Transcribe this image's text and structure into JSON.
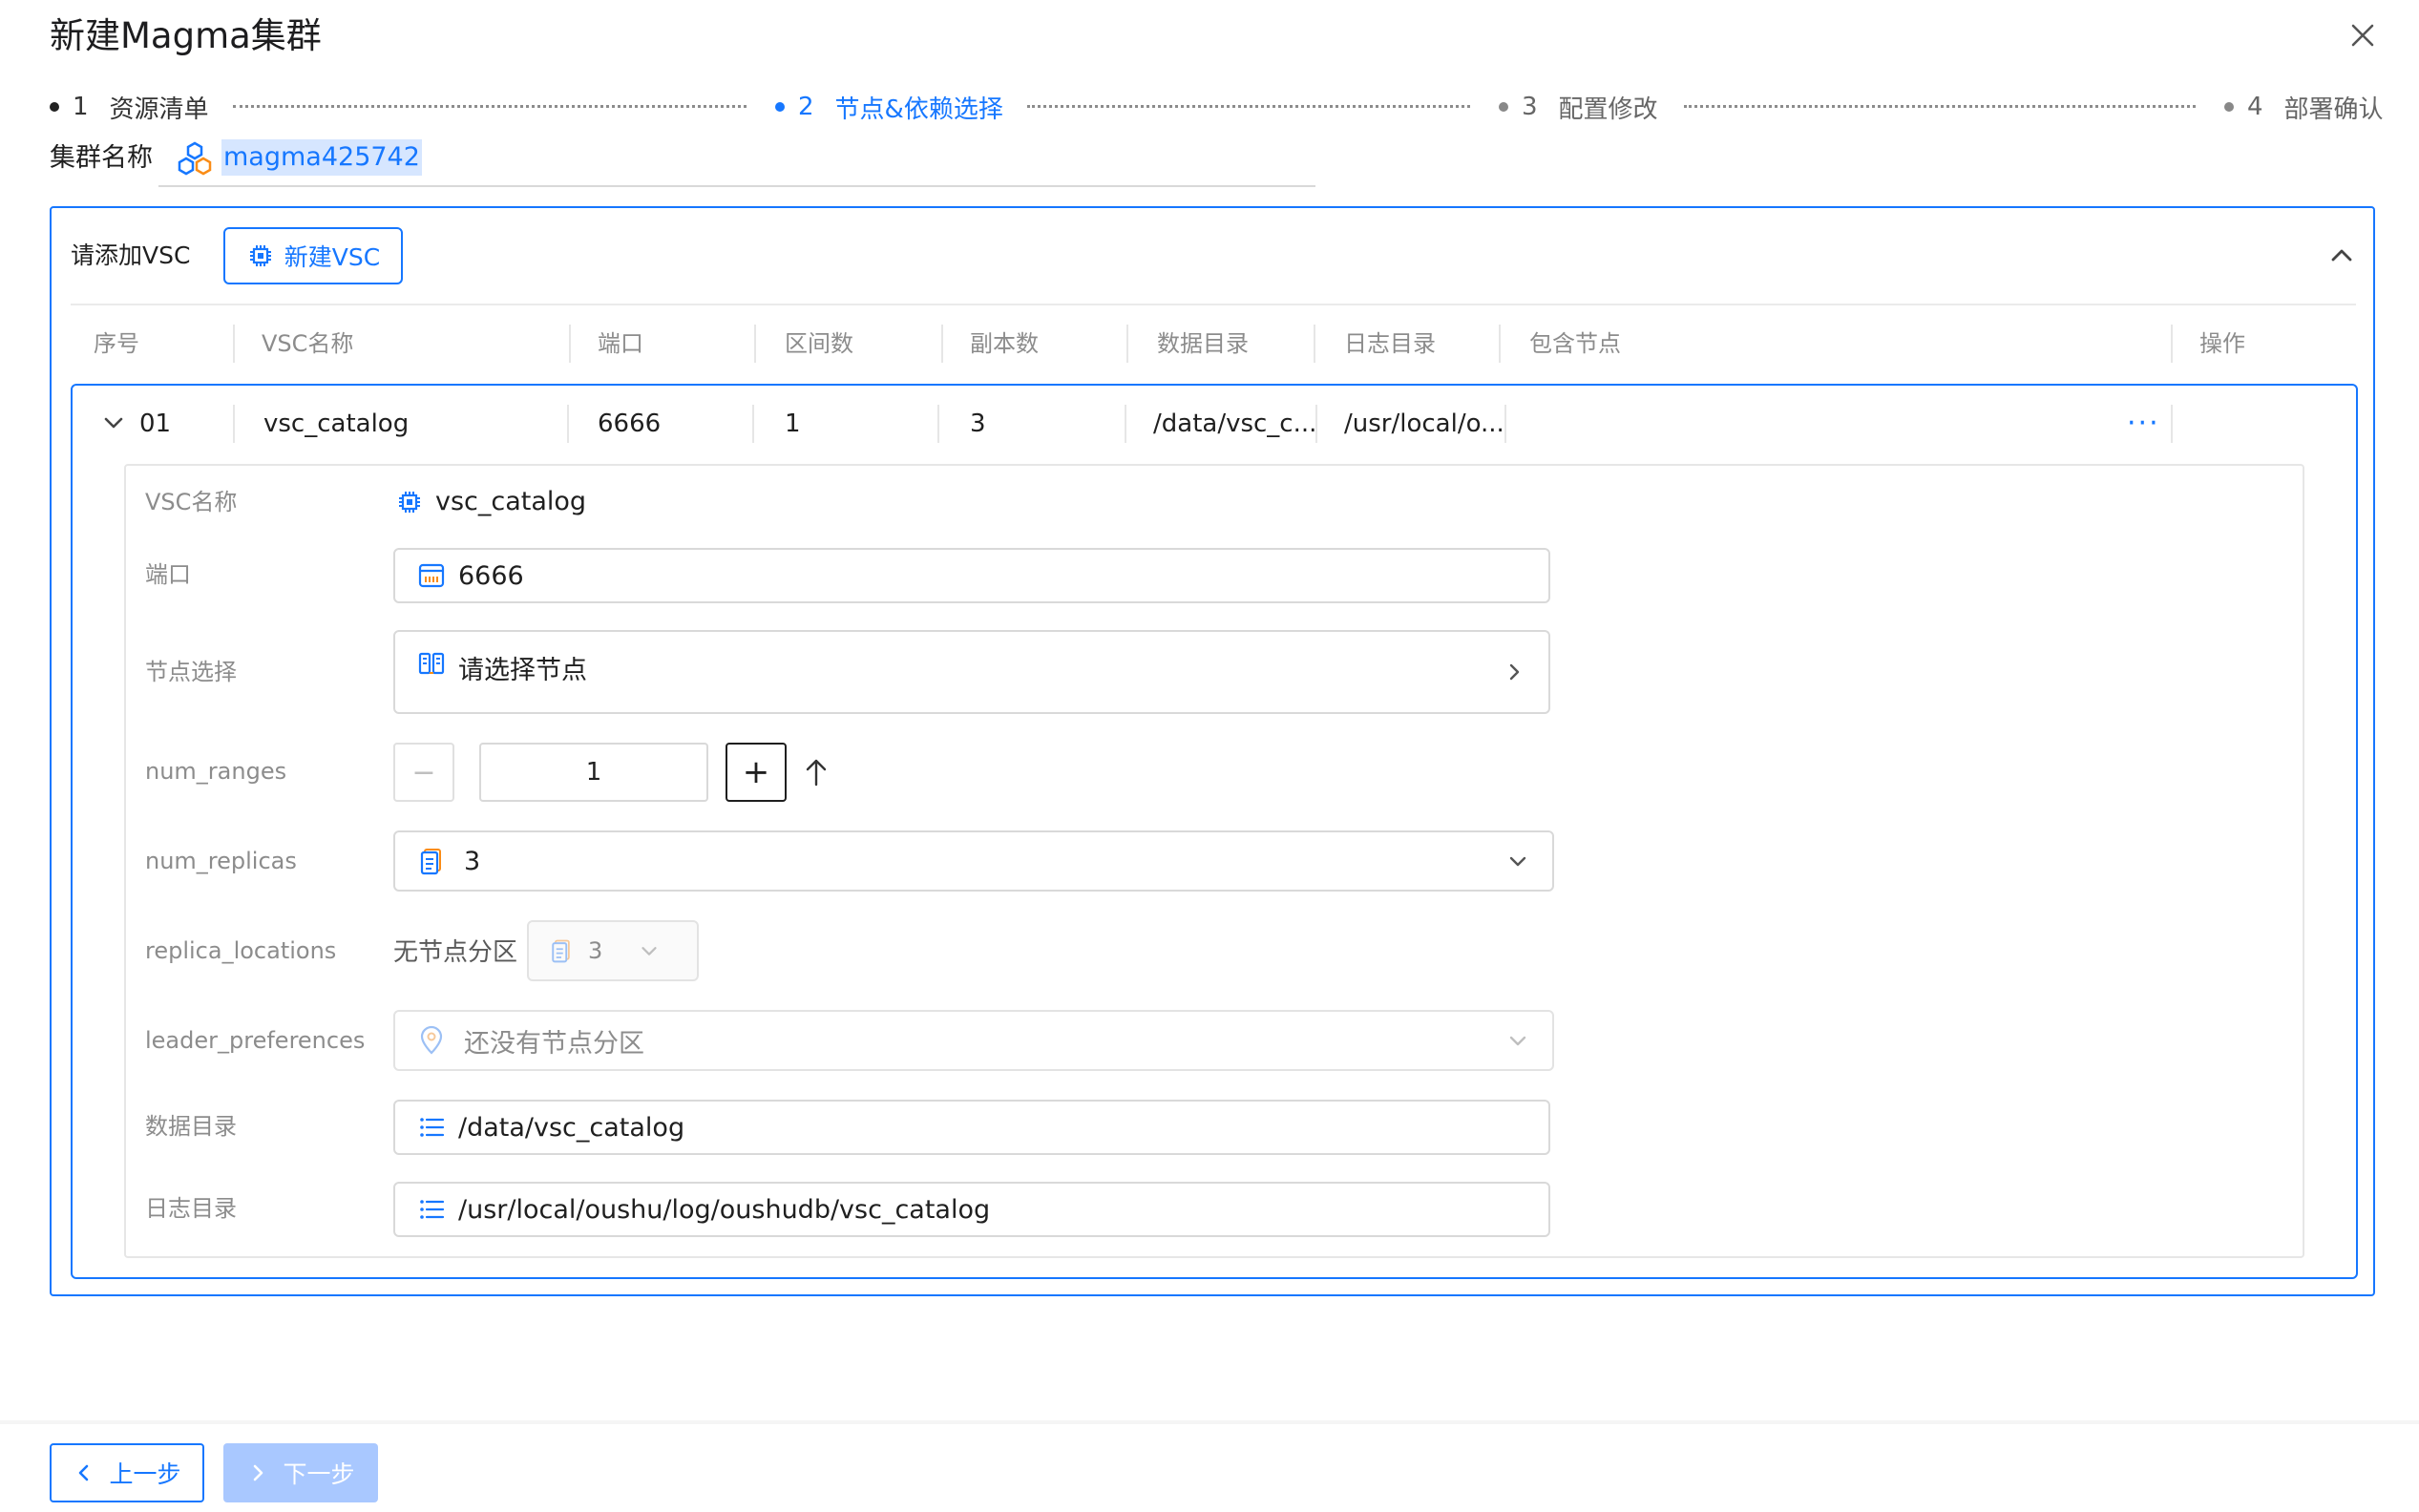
{
  "dialog": {
    "title": "新建Magma集群"
  },
  "steps": [
    {
      "num": "1",
      "label": "资源清单",
      "state": "done"
    },
    {
      "num": "2",
      "label": "节点&依赖选择",
      "state": "active"
    },
    {
      "num": "3",
      "label": "配置修改",
      "state": "pending"
    },
    {
      "num": "4",
      "label": "部署确认",
      "state": "pending"
    }
  ],
  "cluster": {
    "label": "集群名称",
    "value": "magma425742"
  },
  "vsc_section": {
    "add_label": "请添加VSC",
    "new_button": "新建VSC"
  },
  "table": {
    "headers": [
      "序号",
      "VSC名称",
      "端口",
      "区间数",
      "副本数",
      "数据目录",
      "日志目录",
      "包含节点",
      "操作"
    ],
    "rows": [
      {
        "index": "01",
        "name": "vsc_catalog",
        "port": "6666",
        "ranges": "1",
        "replicas": "3",
        "data_dir": "/data/vsc_c...",
        "log_dir": "/usr/local/o...",
        "nodes": "",
        "action": "···"
      }
    ]
  },
  "detail": {
    "vsc_name": {
      "label": "VSC名称",
      "value": "vsc_catalog"
    },
    "port": {
      "label": "端口",
      "value": "6666"
    },
    "node_select": {
      "label": "节点选择",
      "placeholder": "请选择节点"
    },
    "num_ranges": {
      "label": "num_ranges",
      "value": "1",
      "minus": "−",
      "plus": "+"
    },
    "num_replicas": {
      "label": "num_replicas",
      "value": "3"
    },
    "replica_locations": {
      "label": "replica_locations",
      "text": "无节点分区",
      "value": "3"
    },
    "leader_preferences": {
      "label": "leader_preferences",
      "placeholder": "还没有节点分区"
    },
    "data_dir": {
      "label": "数据目录",
      "value": "/data/vsc_catalog"
    },
    "log_dir": {
      "label": "日志目录",
      "value": "/usr/local/oushu/log/oushudb/vsc_catalog"
    }
  },
  "footer": {
    "prev": "上一步",
    "next": "下一步"
  },
  "colors": {
    "primary": "#1677ff",
    "disabled": "#a9c8ff",
    "border": "#d9d9d9",
    "muted": "#8c8c8c"
  },
  "icons": [
    "close-icon",
    "cluster-icon",
    "chip-icon",
    "chevron-up-icon",
    "chevron-down-icon",
    "more-icon",
    "port-icon",
    "node-icon",
    "chevron-right-icon",
    "arrow-up-icon",
    "replica-icon",
    "location-icon",
    "list-icon",
    "chevron-left-icon"
  ]
}
